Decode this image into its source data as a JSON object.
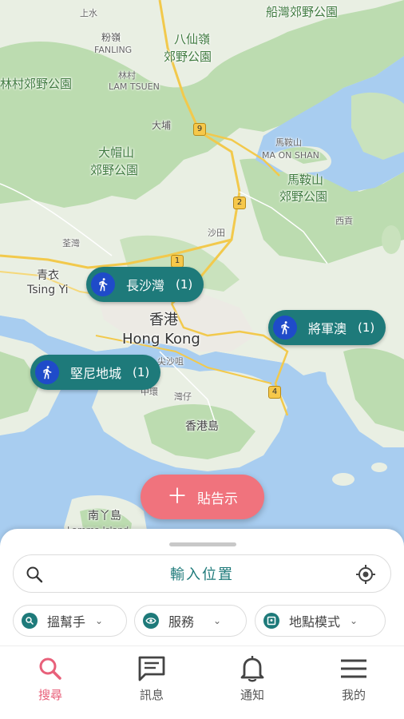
{
  "map": {
    "labels": {
      "sheung_shui": "上水",
      "fanling_zh": "粉嶺",
      "fanling_en": "FANLING",
      "pat_sin_leng": "八仙嶺",
      "pat_sin_leng_park": "郊野公園",
      "plover_cove": "船灣郊野公園",
      "tai_lam": "林村郊野公園",
      "lam_tsuen_zh": "林村",
      "lam_tsuen_en": "LAM TSUEN",
      "tai_po": "大埔",
      "tai_mo_shan": "大帽山",
      "tai_mo_shan_park": "郊野公園",
      "ma_on_shan_zh": "馬鞍山",
      "ma_on_shan_en": "MA ON SHAN",
      "ma_on_shan_cp": "馬鞍山",
      "ma_on_shan_park": "郊野公園",
      "sai_kung": "西貢",
      "tsuen_wan": "荃灣",
      "sha_tin": "沙田",
      "tsing_yi_zh": "青衣",
      "tsing_yi_en": "Tsing Yi",
      "hk_zh": "香港",
      "hk_en": "Hong Kong",
      "tsim_sha_tsui": "尖沙咀",
      "central": "中環",
      "wan_chai": "灣仔",
      "hk_island": "香港島",
      "lamma_zh": "南丫島",
      "lamma_en": "Lamma Island"
    },
    "shields": [
      "9",
      "2",
      "1",
      "4"
    ],
    "markers": [
      {
        "name": "長沙灣",
        "count": "(1)",
        "icon": "walking-person-icon"
      },
      {
        "name": "將軍澳",
        "count": "(1)",
        "icon": "walking-person-icon"
      },
      {
        "name": "堅尼地城",
        "count": "(1)",
        "icon": "walking-person-icon"
      }
    ]
  },
  "post_button": {
    "label": "貼告示",
    "icon": "plus-icon"
  },
  "search": {
    "placeholder": "輸入位置",
    "left_icon": "search-icon",
    "right_icon": "my-location-icon"
  },
  "filters": [
    {
      "label": "搵幫手",
      "icon": "search-icon"
    },
    {
      "label": "服務",
      "icon": "eye-icon"
    },
    {
      "label": "地點模式",
      "icon": "map-icon"
    }
  ],
  "nav": [
    {
      "label": "搜尋",
      "icon": "search-icon",
      "active": true
    },
    {
      "label": "訊息",
      "icon": "message-icon",
      "active": false
    },
    {
      "label": "通知",
      "icon": "bell-icon",
      "active": false
    },
    {
      "label": "我的",
      "icon": "menu-icon",
      "active": false
    }
  ],
  "colors": {
    "accent": "#1e7a7a",
    "pink": "#f0737d",
    "active_nav": "#e8607a",
    "marker_icon_bg": "#1f4bc9",
    "water": "#a8cdf0",
    "land": "#e9efe3",
    "park": "#bcdcb0"
  }
}
